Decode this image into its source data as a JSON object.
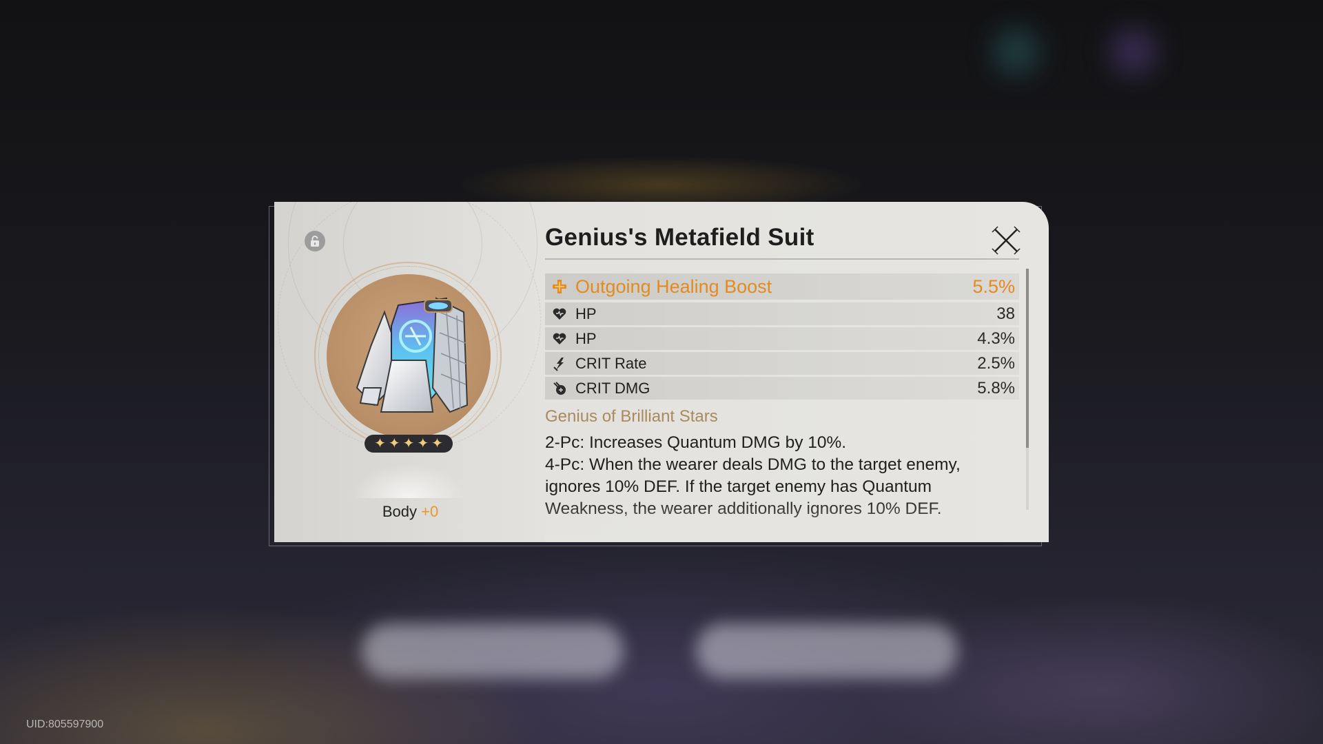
{
  "relic": {
    "name": "Genius's Metafield Suit",
    "slot": "Body",
    "level": "+0",
    "stars": [
      "✦",
      "✦",
      "✦",
      "✦",
      "✦"
    ]
  },
  "main_stat": {
    "icon": "healing-cross-icon",
    "label": "Outgoing Healing Boost",
    "value": "5.5%",
    "color": "#e38b1f"
  },
  "sub_stats": [
    {
      "icon": "hp-heart-icon",
      "label": "HP",
      "value": "38"
    },
    {
      "icon": "hp-heart-icon",
      "label": "HP",
      "value": "4.3%"
    },
    {
      "icon": "crit-rate-icon",
      "label": "CRIT Rate",
      "value": "2.5%"
    },
    {
      "icon": "crit-dmg-icon",
      "label": "CRIT DMG",
      "value": "5.8%"
    }
  ],
  "set": {
    "name": "Genius of Brilliant Stars",
    "bonus_2pc": "2-Pc: Increases Quantum DMG by 10%.",
    "bonus_4pc": "4-Pc: When the wearer deals DMG to the target enemy, ignores 10% DEF. If the target enemy has Quantum Weakness, the wearer additionally ignores 10% DEF."
  },
  "uid": "UID:805597900",
  "icons": {
    "lock": "lock-icon",
    "close": "close-icon"
  }
}
